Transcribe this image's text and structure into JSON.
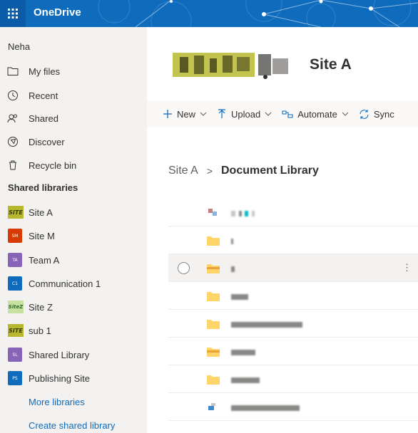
{
  "app": {
    "name": "OneDrive",
    "brand_color": "#0f6cbd"
  },
  "nav": {
    "user_name": "Neha",
    "items": [
      {
        "label": "My files",
        "icon": "folder-icon"
      },
      {
        "label": "Recent",
        "icon": "clock-icon"
      },
      {
        "label": "Shared",
        "icon": "people-icon"
      },
      {
        "label": "Discover",
        "icon": "compass-icon"
      },
      {
        "label": "Recycle bin",
        "icon": "trash-icon"
      }
    ]
  },
  "shared_libraries": {
    "title": "Shared libraries",
    "items": [
      {
        "label": "Site A",
        "badge": "SITE",
        "icon": "site-logo-icon"
      },
      {
        "label": "Site M",
        "badge": "SM",
        "color": "#d83b01"
      },
      {
        "label": "Team A",
        "badge": "TA",
        "color": "#8764b8"
      },
      {
        "label": "Communication 1",
        "badge": "C1",
        "color": "#0f6cbd"
      },
      {
        "label": "Site Z",
        "badge": "SiteZ",
        "icon": "site-z-logo-icon"
      },
      {
        "label": "sub 1",
        "badge": "SITE",
        "icon": "site-logo-icon"
      },
      {
        "label": "Shared Library",
        "badge": "SL",
        "color": "#8764b8"
      },
      {
        "label": "Publishing Site",
        "badge": "PS",
        "color": "#0f6cbd"
      }
    ],
    "more_label": "More libraries",
    "create_label": "Create shared library"
  },
  "site": {
    "title": "Site A",
    "logo_text": "SITE"
  },
  "commands": {
    "new": "New",
    "upload": "Upload",
    "automate": "Automate",
    "sync": "Sync"
  },
  "breadcrumb": {
    "root": "Site A",
    "separator": ">",
    "current": "Document Library"
  },
  "files": [
    {
      "type": "image",
      "selected": false
    },
    {
      "type": "folder",
      "selected": false
    },
    {
      "type": "folder-alt",
      "selected": true,
      "more": "⋮"
    },
    {
      "type": "folder",
      "selected": false
    },
    {
      "type": "folder",
      "selected": false
    },
    {
      "type": "folder-alt",
      "selected": false
    },
    {
      "type": "folder",
      "selected": false
    },
    {
      "type": "image",
      "selected": false
    }
  ]
}
